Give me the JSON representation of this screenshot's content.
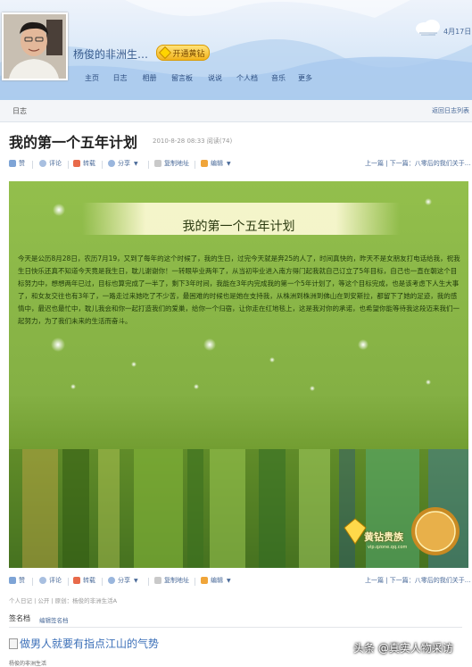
{
  "header": {
    "username": "杨俊的非洲生…",
    "vip_label": "开通黄钻",
    "date": "4月17日",
    "nav": [
      "主页",
      "日志",
      "相册",
      "留言板",
      "说说",
      "个人档",
      "音乐",
      "更多"
    ]
  },
  "subbar": {
    "title": "日志",
    "back_link": "返回日志列表"
  },
  "post": {
    "title": "我的第一个五年计划",
    "meta": "2010-8-28 08:33  阅读(74)"
  },
  "toolbar": {
    "like": "赞",
    "comment": "评论",
    "repost": "转载",
    "share": "分享",
    "copy_link": "复制地址",
    "edit": "编辑",
    "nav_text": "上一篇 | 下一篇：八零后的我们关于..."
  },
  "toolbar2": {
    "like": "赞",
    "comment": "评论",
    "repost": "转载",
    "share": "分享",
    "copy_link": "复制地址",
    "edit": "编辑",
    "nav_text": "上一篇 | 下一篇：八零后的我们关于..."
  },
  "card": {
    "banner_title": "我的第一个五年计划",
    "body": "今天是公历8月28日，农历7月19，又到了每年的这个时候了，我的生日，过完今天就是奔25的人了，时间真快的，昨天不是女朋友打电话给我，祝我生日快乐还真不知道今天竟是我生日，耽儿谢谢你！一转眼毕业两年了，从当初毕业进入南方得门起我就自己订立了5年目标，自己也一直在朝这个目标努力中，想想两年已过，目标也算完成了一半了，剩下3年时间，我能在3年内完成我的第一个5年计划了，等这个目标完成，也是该考虑下人生大事了，和女友交往也有3年了，一路走过来她吃了不少苦，最困难的时候也是她在支持我，从株洲到株洲到佛山在到安斯拉，都留下了她的足迹，我的感情中，最迟也最忙中，耽儿我会和你一起打造我们的爱巢，给你一个归宿，让你走在红地毯上，这是我对你的承诺，也希望你能等待我这段迈来我们一起努力，为了我们未来的生活而奋斗。",
    "logo_text": "黄钻贵族",
    "logo_sub": "vip.qzone.qq.com"
  },
  "footer": {
    "meta": "个人日记 | 公开 | 原创：杨俊的非洲生活A",
    "sig_label": "签名档",
    "sig_edit": "编辑签名档",
    "sig_image_alt": "做男人就要有指点江山的气势",
    "watermark": "头条 @真实人物采访",
    "bottom": "杨俊的非洲生活"
  },
  "icons": {
    "like": "thumb-up-icon",
    "comment": "speech-bubble-icon",
    "repost": "repost-icon",
    "share": "share-icon",
    "copy": "copy-icon",
    "edit": "pencil-icon",
    "weather": "cloud-icon"
  },
  "colors": {
    "link": "#4a6a99",
    "card_bg": "#8cb84a",
    "vip": "#f2b21c"
  }
}
